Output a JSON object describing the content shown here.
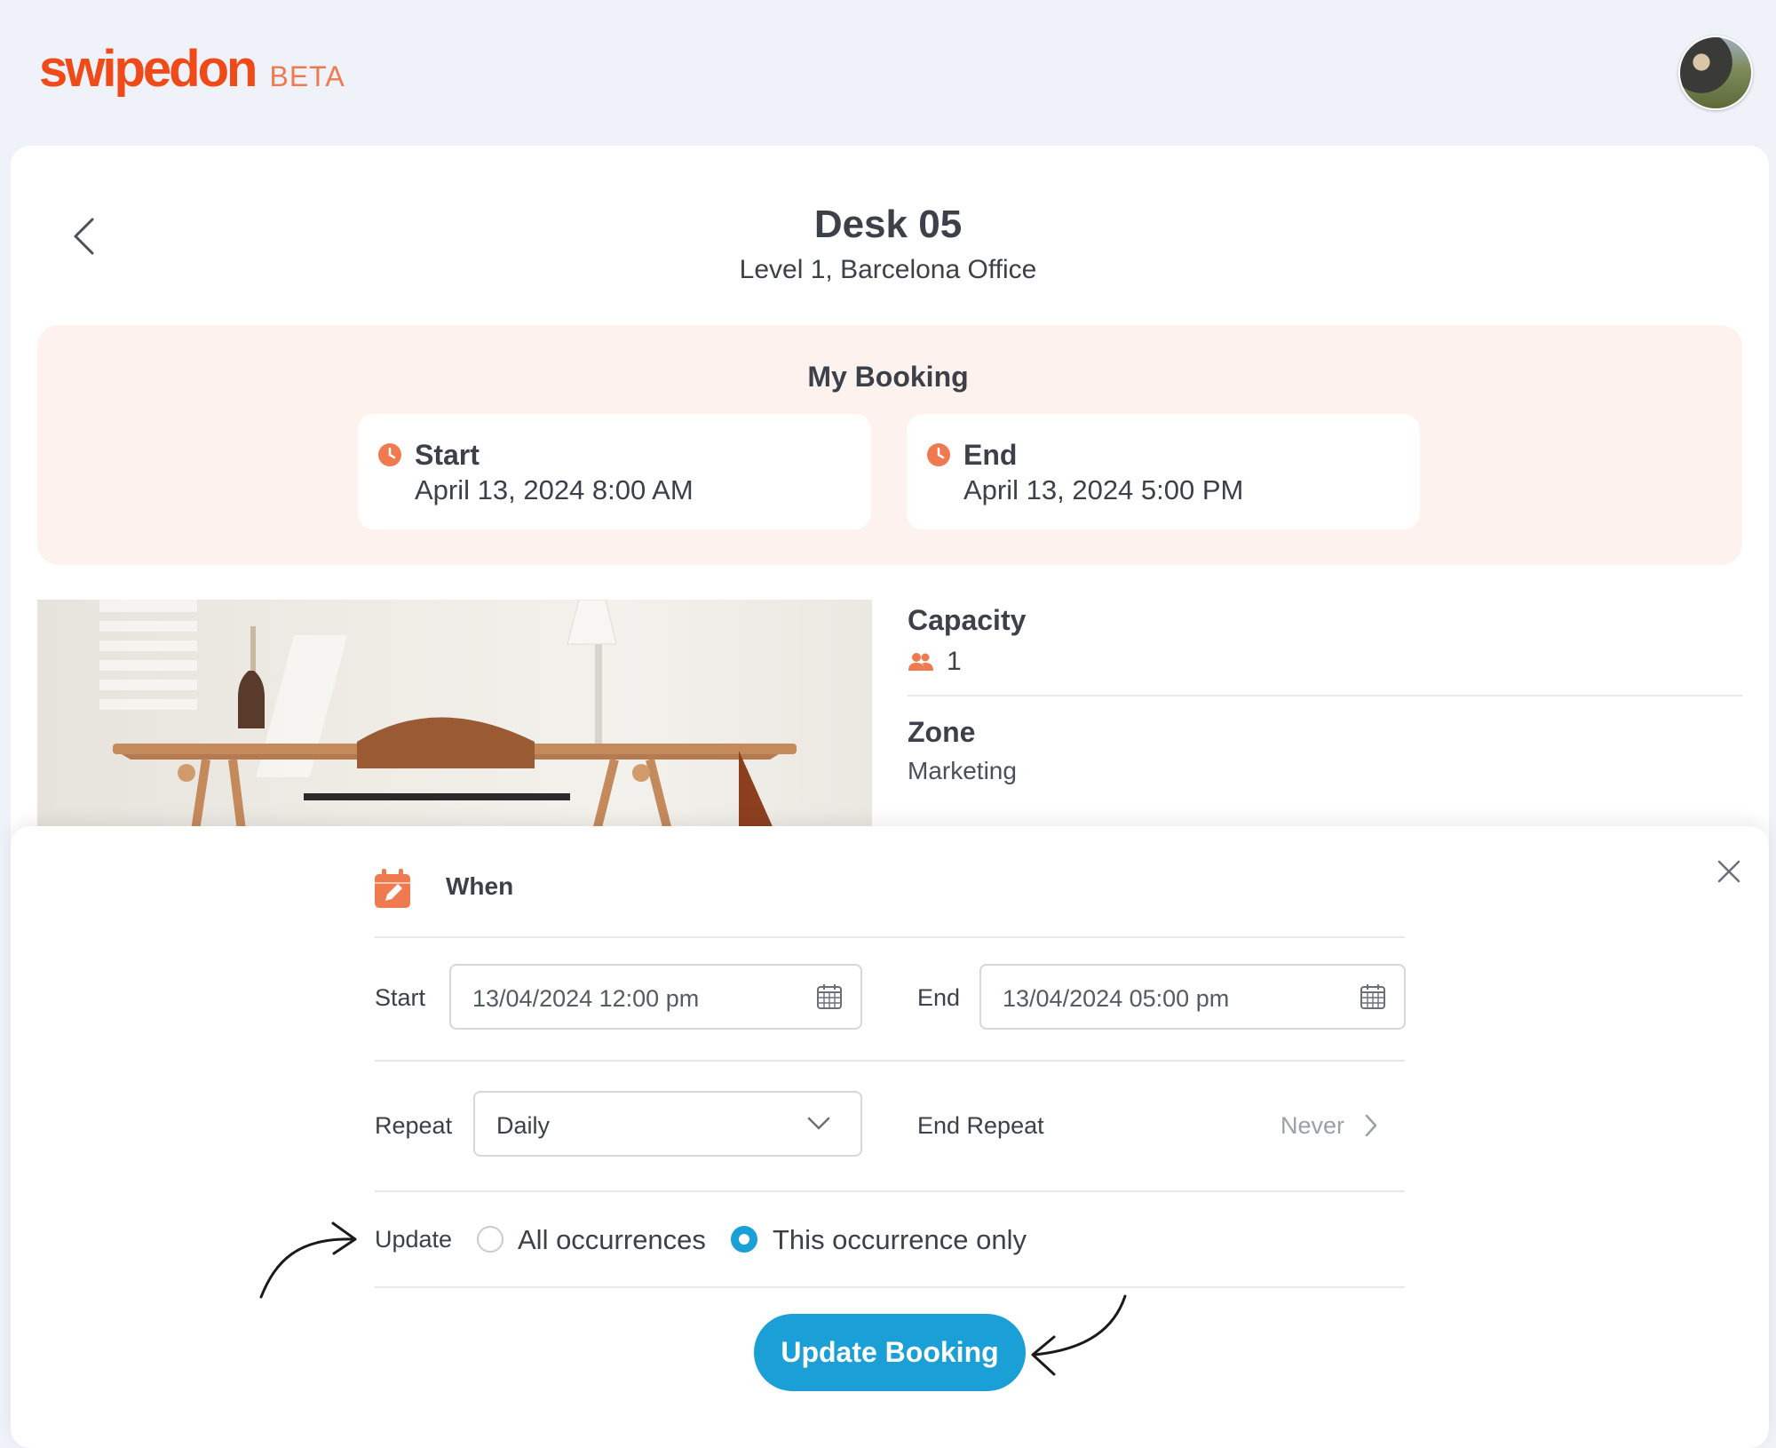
{
  "header": {
    "brand": "swipedon",
    "badge": "BETA"
  },
  "desk": {
    "title": "Desk 05",
    "location": "Level 1, Barcelona Office"
  },
  "booking": {
    "heading": "My Booking",
    "start_label": "Start",
    "start_value": "April 13, 2024 8:00 AM",
    "end_label": "End",
    "end_value": "April 13, 2024 5:00 PM"
  },
  "details": {
    "capacity_label": "Capacity",
    "capacity_value": "1",
    "zone_label": "Zone",
    "zone_value": "Marketing"
  },
  "form": {
    "section_label": "When",
    "start_label": "Start",
    "start_value": "13/04/2024 12:00 pm",
    "end_label": "End",
    "end_value": "13/04/2024 05:00 pm",
    "repeat_label": "Repeat",
    "repeat_value": "Daily",
    "end_repeat_label": "End Repeat",
    "end_repeat_value": "Never",
    "update_label": "Update",
    "options": [
      {
        "label": "All occurrences",
        "selected": false
      },
      {
        "label": "This occurrence only",
        "selected": true
      }
    ],
    "submit_label": "Update Booking"
  },
  "colors": {
    "brand": "#ef4a17",
    "accent": "#1a9fd6",
    "booking_bg": "#fdf2ee",
    "icon_orange": "#f07a4f"
  },
  "icons": [
    "chevron-left-icon",
    "clock-icon",
    "people-icon",
    "calendar-edit-icon",
    "close-icon",
    "calendar-icon",
    "chevron-down-icon",
    "chevron-right-icon"
  ]
}
